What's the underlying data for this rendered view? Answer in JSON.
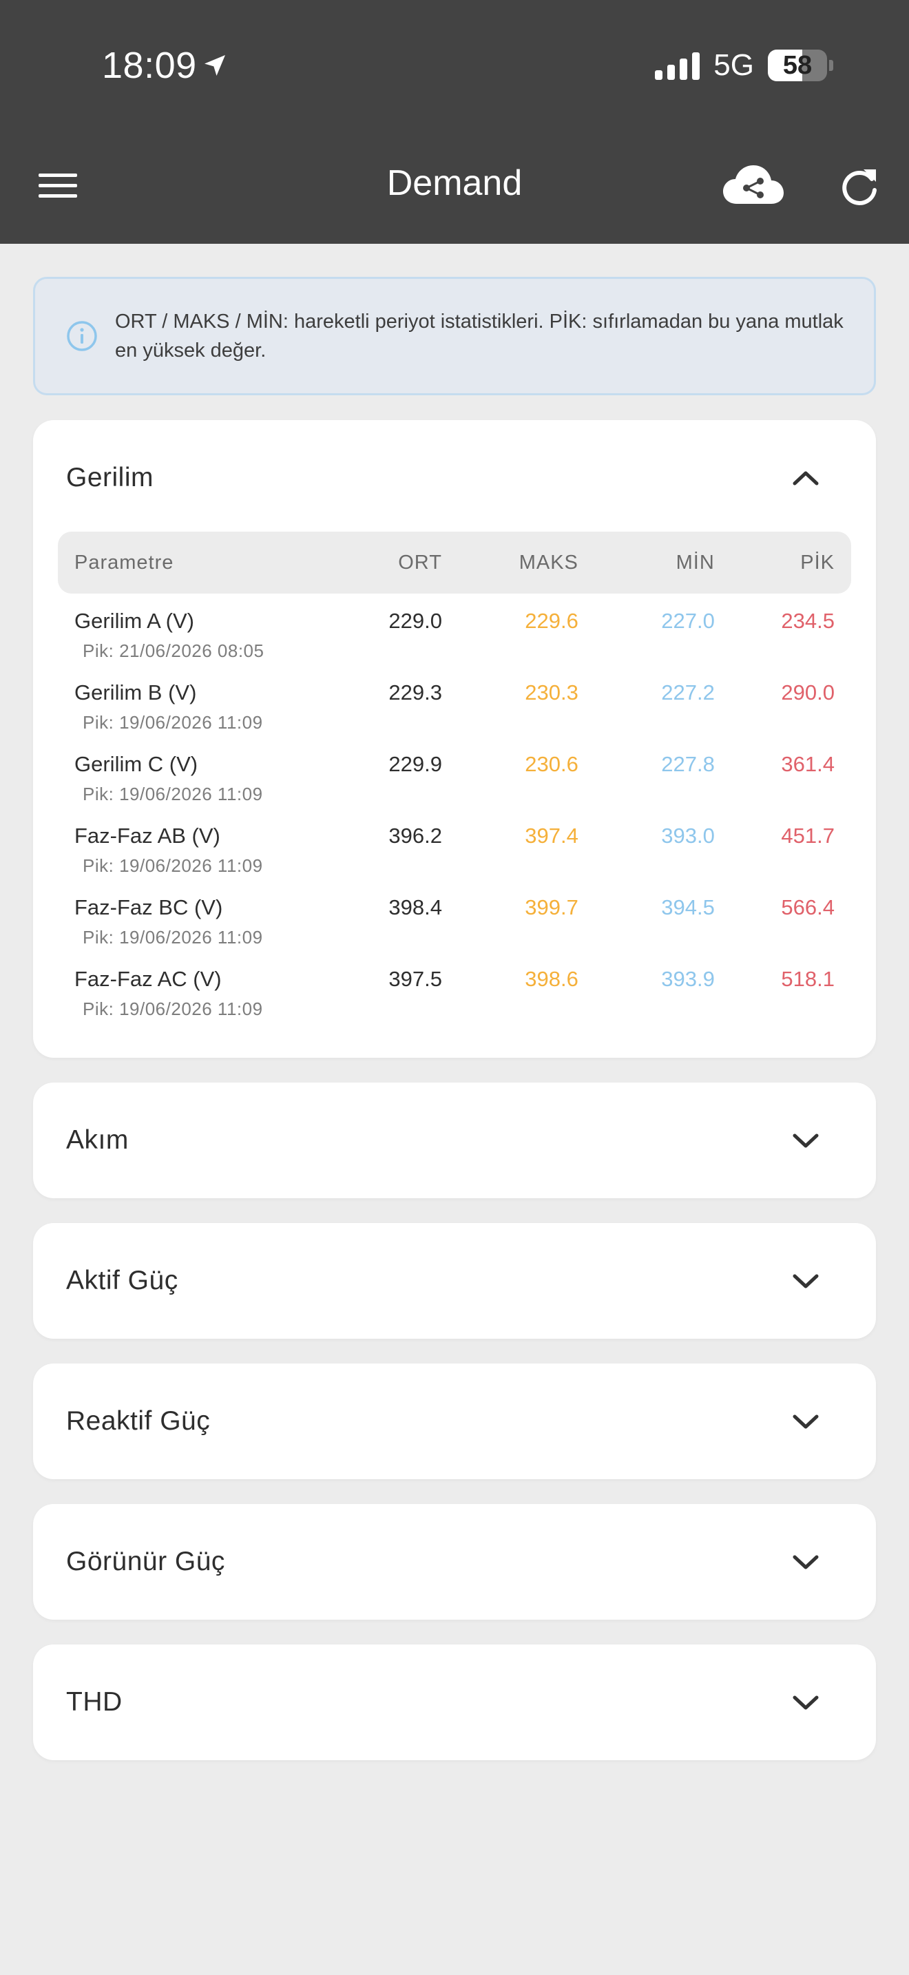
{
  "status": {
    "time": "18:09",
    "network": "5G",
    "battery": "58",
    "battery_level_percent": 58
  },
  "appbar": {
    "title": "Demand",
    "icons": {
      "menu": "menu-icon",
      "cloud": "cloud-share-icon",
      "refresh": "refresh-icon"
    }
  },
  "info": {
    "icon": "info-icon",
    "text": "ORT / MAKS / MİN: hareketli periyot istatistikleri. PİK: sıfırlamadan bu yana mutlak en yüksek değer."
  },
  "colors": {
    "header_bg": "#434343",
    "maks": "#f5b03a",
    "min": "#8ec6ec",
    "pik": "#e0616a",
    "info_bg": "#e4e9f0",
    "info_border": "#c5dcef"
  },
  "sections": {
    "gerilim": {
      "title": "Gerilim",
      "expanded": true,
      "columns": [
        "Parametre",
        "ORT",
        "MAKS",
        "MİN",
        "PİK"
      ],
      "rows": [
        {
          "name": "Gerilim A (V)",
          "ort": "229.0",
          "maks": "229.6",
          "min": "227.0",
          "pik": "234.5",
          "peak_time": "Pik: 21/06/2026 08:05"
        },
        {
          "name": "Gerilim B (V)",
          "ort": "229.3",
          "maks": "230.3",
          "min": "227.2",
          "pik": "290.0",
          "peak_time": "Pik: 19/06/2026 11:09"
        },
        {
          "name": "Gerilim C (V)",
          "ort": "229.9",
          "maks": "230.6",
          "min": "227.8",
          "pik": "361.4",
          "peak_time": "Pik: 19/06/2026 11:09"
        },
        {
          "name": "Faz-Faz AB (V)",
          "ort": "396.2",
          "maks": "397.4",
          "min": "393.0",
          "pik": "451.7",
          "peak_time": "Pik: 19/06/2026 11:09"
        },
        {
          "name": "Faz-Faz BC (V)",
          "ort": "398.4",
          "maks": "399.7",
          "min": "394.5",
          "pik": "566.4",
          "peak_time": "Pik: 19/06/2026 11:09"
        },
        {
          "name": "Faz-Faz AC (V)",
          "ort": "397.5",
          "maks": "398.6",
          "min": "393.9",
          "pik": "518.1",
          "peak_time": "Pik: 19/06/2026 11:09"
        }
      ]
    },
    "akim": {
      "title": "Akım",
      "expanded": false
    },
    "aktif_guc": {
      "title": "Aktif Güç",
      "expanded": false
    },
    "reaktif_guc": {
      "title": "Reaktif Güç",
      "expanded": false
    },
    "gorunur_guc": {
      "title": "Görünür Güç",
      "expanded": false
    },
    "thd": {
      "title": "THD",
      "expanded": false
    }
  }
}
